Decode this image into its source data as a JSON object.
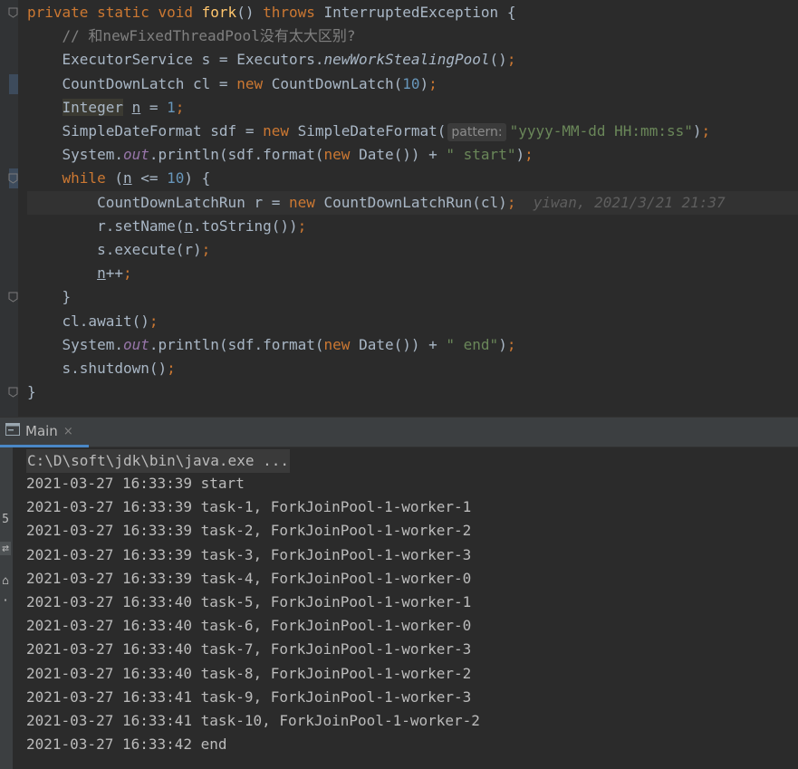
{
  "code_lines": [
    [
      {
        "t": "private static void ",
        "c": "k"
      },
      {
        "t": "fork",
        "c": "fn"
      },
      {
        "t": "() "
      },
      {
        "t": "throws ",
        "c": "k"
      },
      {
        "t": "InterruptedException {"
      }
    ],
    [
      {
        "t": "    // 和newFixedThreadPool没有太大区别?",
        "c": "cmt"
      }
    ],
    [
      {
        "t": "    ExecutorService s = Executors."
      },
      {
        "t": "newWorkStealingPool",
        "c": "it"
      },
      {
        "t": "()"
      },
      {
        "t": ";",
        "c": "k"
      }
    ],
    [
      {
        "t": "    CountDownLatch cl = "
      },
      {
        "t": "new ",
        "c": "k"
      },
      {
        "t": "CountDownLatch("
      },
      {
        "t": "10",
        "c": "num"
      },
      {
        "t": ")"
      },
      {
        "t": ";",
        "c": "k"
      }
    ],
    [
      {
        "t": "    "
      },
      {
        "t": "Integer",
        "c": "hl"
      },
      {
        "t": " "
      },
      {
        "t": "n",
        "c": "ul"
      },
      {
        "t": " = "
      },
      {
        "t": "1",
        "c": "num"
      },
      {
        "t": ";",
        "c": "k"
      }
    ],
    [
      {
        "t": "    SimpleDateFormat sdf = "
      },
      {
        "t": "new ",
        "c": "k"
      },
      {
        "t": "SimpleDateFormat("
      },
      {
        "t": "pattern:",
        "c": "hint"
      },
      {
        "t": "\"yyyy-MM-dd HH:mm:ss\"",
        "c": "str"
      },
      {
        "t": ")"
      },
      {
        "t": ";",
        "c": "k"
      }
    ],
    [
      {
        "t": "    System."
      },
      {
        "t": "out",
        "c": "sf"
      },
      {
        "t": ".println(sdf.format("
      },
      {
        "t": "new ",
        "c": "k"
      },
      {
        "t": "Date()) + "
      },
      {
        "t": "\" start\"",
        "c": "str"
      },
      {
        "t": ")"
      },
      {
        "t": ";",
        "c": "k"
      }
    ],
    [
      {
        "t": "    "
      },
      {
        "t": "while ",
        "c": "k"
      },
      {
        "t": "("
      },
      {
        "t": "n",
        "c": "ul"
      },
      {
        "t": " <= "
      },
      {
        "t": "10",
        "c": "num"
      },
      {
        "t": ") {"
      }
    ],
    [
      {
        "t": "        CountDownLatchRun r = "
      },
      {
        "t": "new ",
        "c": "k"
      },
      {
        "t": "CountDownLatchRun(cl)"
      },
      {
        "t": ";",
        "c": "k"
      },
      {
        "t": "  yiwan, 2021/3/21 21:37",
        "c": "blame"
      }
    ],
    [
      {
        "t": "        r.setName("
      },
      {
        "t": "n",
        "c": "ul"
      },
      {
        "t": ".toString())"
      },
      {
        "t": ";",
        "c": "k"
      }
    ],
    [
      {
        "t": "        s.execute(r)"
      },
      {
        "t": ";",
        "c": "k"
      }
    ],
    [
      {
        "t": "        "
      },
      {
        "t": "n",
        "c": "ul"
      },
      {
        "t": "++"
      },
      {
        "t": ";",
        "c": "k"
      }
    ],
    [
      {
        "t": "    }"
      }
    ],
    [
      {
        "t": "    cl.await()"
      },
      {
        "t": ";",
        "c": "k"
      }
    ],
    [
      {
        "t": "    System."
      },
      {
        "t": "out",
        "c": "sf"
      },
      {
        "t": ".println(sdf.format("
      },
      {
        "t": "new ",
        "c": "k"
      },
      {
        "t": "Date()) + "
      },
      {
        "t": "\" end\"",
        "c": "str"
      },
      {
        "t": ")"
      },
      {
        "t": ";",
        "c": "k"
      }
    ],
    [
      {
        "t": "    s.shutdown()"
      },
      {
        "t": ";",
        "c": "k"
      }
    ],
    [
      {
        "t": "}"
      }
    ]
  ],
  "run_tab": {
    "label": "Main",
    "close": "×"
  },
  "console": {
    "command": "C:\\D\\soft\\jdk\\bin\\java.exe ...",
    "lines": [
      "2021-03-27 16:33:39 start",
      "2021-03-27 16:33:39 task-1, ForkJoinPool-1-worker-1",
      "2021-03-27 16:33:39 task-2, ForkJoinPool-1-worker-2",
      "2021-03-27 16:33:39 task-3, ForkJoinPool-1-worker-3",
      "2021-03-27 16:33:39 task-4, ForkJoinPool-1-worker-0",
      "2021-03-27 16:33:40 task-5, ForkJoinPool-1-worker-1",
      "2021-03-27 16:33:40 task-6, ForkJoinPool-1-worker-0",
      "2021-03-27 16:33:40 task-7, ForkJoinPool-1-worker-3",
      "2021-03-27 16:33:40 task-8, ForkJoinPool-1-worker-2",
      "2021-03-27 16:33:41 task-9, ForkJoinPool-1-worker-3",
      "2021-03-27 16:33:41 task-10, ForkJoinPool-1-worker-2",
      "2021-03-27 16:33:42 end"
    ],
    "gutter_glyphs": [
      "5",
      "⇄",
      "⌂",
      "·"
    ]
  },
  "icons": {
    "fold": "fold-marker-icon",
    "run_console": "console-icon",
    "tab_close": "close-icon"
  }
}
